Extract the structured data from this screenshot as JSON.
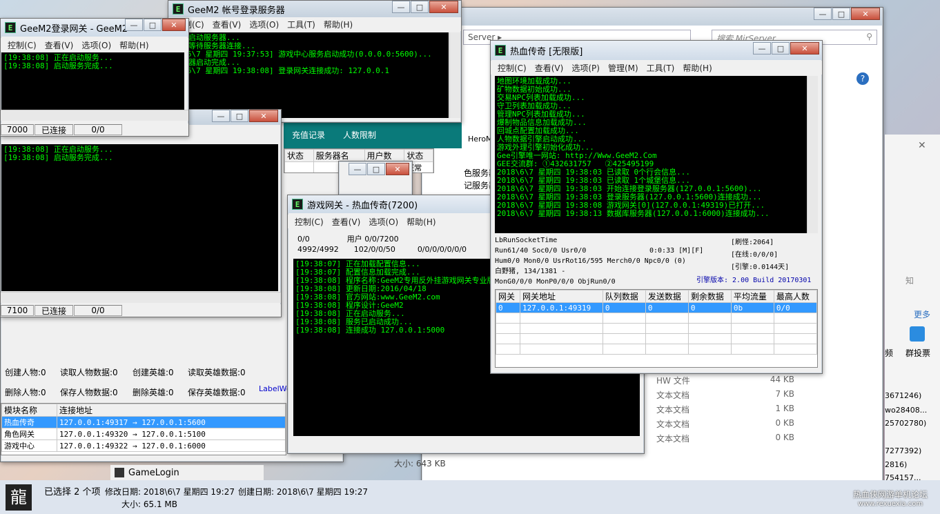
{
  "background_explorer": {
    "address": "Server",
    "search_placeholder": "搜索 MirServer",
    "files": [
      {
        "type": "HW 文件",
        "size": "44 KB"
      },
      {
        "type": "文本文档",
        "size": "7 KB"
      },
      {
        "type": "文本文档",
        "size": "1 KB"
      },
      {
        "type": "文本文档",
        "size": "0 KB"
      },
      {
        "type": "文本文档",
        "size": "0 KB"
      }
    ],
    "size_label": "大小: 643 KB",
    "right_numbers": [
      "3671246)",
      "wo28408...",
      "25702780)",
      "7277392)",
      "2816)",
      "754157..."
    ],
    "right_more": "更多",
    "right_label1": "知",
    "right_label2": "频",
    "right_label3": "群投票"
  },
  "game_login_window": {
    "title": "GeeM2 帐号登录服务器",
    "menu": [
      "控制(C)",
      "查看(V)",
      "选项(O)",
      "工具(T)",
      "帮助(H)"
    ],
    "console": "正在启动服务器...\n正在等待服务器连接...\n18\\6\\7 星期四 19:37:53] 游戏中心服务启动成功(0.0.0.0:5600)...\n服务器启动完成...\n18\\6\\7 星期四 19:38:08] 登录网关连接成功: 127.0.0.1"
  },
  "login_gateway": {
    "title": "GeeM2登录网关 - GeeM2",
    "menu": [
      "控制(C)",
      "查看(V)",
      "选项(O)",
      "帮助(H)"
    ],
    "console": "[19:38:08] 正在启动服务...\n[19:38:08] 启动服务完成...",
    "status": [
      "7000",
      "已连接",
      "0/0"
    ]
  },
  "select_gateway": {
    "console": "[19:38:08] 正在启动服务...\n[19:38:08] 启动服务完成...",
    "status": [
      "7100",
      "已连接",
      "0/0"
    ]
  },
  "db_server": {
    "tabs": [
      "充值记录",
      "人数限制"
    ],
    "grid_headers": [
      "状态",
      "服务器名",
      "用户数",
      "状态"
    ],
    "grid_cell": "正常",
    "labels": [
      "创建人物:0",
      "读取人物数据:0",
      "创建英雄:0",
      "读取英雄数据:0",
      "删除人物:0",
      "保存人物数据:0",
      "删除英雄:0",
      "保存英雄数据:0"
    ],
    "link": "LabelWo",
    "modules_headers": [
      "模块名称",
      "连接地址"
    ],
    "modules": [
      {
        "name": "热血传奇",
        "addr": "127.0.0.1:49317 → 127.0.0.1:5600"
      },
      {
        "name": "角色网关",
        "addr": "127.0.0.1:49320 → 127.0.0.1:5100"
      },
      {
        "name": "游戏中心",
        "addr": "127.0.0.1:49322 → 127.0.0.1:6000"
      }
    ],
    "side_text": [
      "HeroM",
      "色服务器",
      "记服务器"
    ]
  },
  "game_gateway": {
    "title": "游戏网关 - 热血传奇(7200)",
    "menu": [
      "控制(C)",
      "查看(V)",
      "选项(O)",
      "帮助(H)"
    ],
    "stats_row1": [
      "0/0",
      "用户 0/0/7200"
    ],
    "stats_row2": [
      "4992/4992",
      "102/0/0/50",
      "0/0/0/0/0/0/0"
    ],
    "console": "[19:38:07] 正在加载配置信息...\n[19:38:07] 配置信息加载完成...\n[19:38:08] 程序名称:GeeM2专用反外挂游戏网关专业版\n[19:38:08] 更新日期:2016/04/18\n[19:38:08] 官方网站:www.GeeM2.com\n[19:38:08] 程序设计:GeeM2\n[19:38:08] 正在启动服务...\n[19:38:08] 服务已启动成功...\n[19:38:08] 连接成功 127.0.0.1:5000"
  },
  "m2_server": {
    "title": "热血传奇 [无限版]",
    "menu": [
      "控制(C)",
      "查看(V)",
      "选项(P)",
      "管理(M)",
      "工具(T)",
      "帮助(H)"
    ],
    "console": "地图环境加载成功...\n矿物数据初始成功...\n交易NPC列表加载成功...\n守卫列表加载成功...\n管理NPC列表加载成功...\n爆制物品信息加载成功...\n回城点配置加载成功...\n人物数据引擎启动成功...\n游戏外理引擎初始化成功...\nGee引擎唯一网站: http://Www.GeeM2.Com\nGEE交流群: ①432631757   ②425495199\n2018\\6\\7 星期四 19:38:03 已读取 0个行会信息...\n2018\\6\\7 星期四 19:38:03 已读取 1个城堡信息...\n2018\\6\\7 星期四 19:38:03 开始连接登录服务器(127.0.0.1:5600)...\n2018\\6\\7 星期四 19:38:03 登录服务器(127.0.0.1:5600)连接成功...\n2018\\6\\7 星期四 19:38:08 游戏网关[0](127.0.0.1:49319)已打开...\n2018\\6\\7 星期四 19:38:13 数据库服务器(127.0.0.1:6000)连接成功...",
    "info_lines": [
      "LbRunSocketTime",
      "Run61/40 Soc0/0 Usr0/0",
      "Hum0/0 Mon0/0 UsrRot16/595 Merch0/0 Npc0/0 (0)",
      "白野猪, 134/1381 -",
      "MonG0/0/0 MonP0/0/0 ObjRun0/0"
    ],
    "time_info": "0:0:33 [M][F]",
    "refresh": "[刷怪:2064]",
    "online": "[在线:0/0/0]",
    "engine": "[引擎:0.0144天]",
    "version": "引擎版本: 2.00 Build 20170301",
    "grid_headers": [
      "网关",
      "网关地址",
      "队列数据",
      "发送数据",
      "剩余数据",
      "平均流量",
      "最高人数"
    ],
    "grid_row": [
      "0",
      "127.0.0.1:49319",
      "0",
      "0",
      "0",
      "0b",
      "0/0"
    ]
  },
  "taskbar": {
    "gamelogin": "GameLogin",
    "selection": "已选择 2 个项",
    "modified": "修改日期: 2018\\6\\7 星期四 19:27",
    "created": "创建日期: 2018\\6\\7 星期四 19:27",
    "size": "大小: 65.1 MB",
    "watermark1": "热血侠网游单机论坛",
    "watermark2": "www.rexuexia.com"
  }
}
